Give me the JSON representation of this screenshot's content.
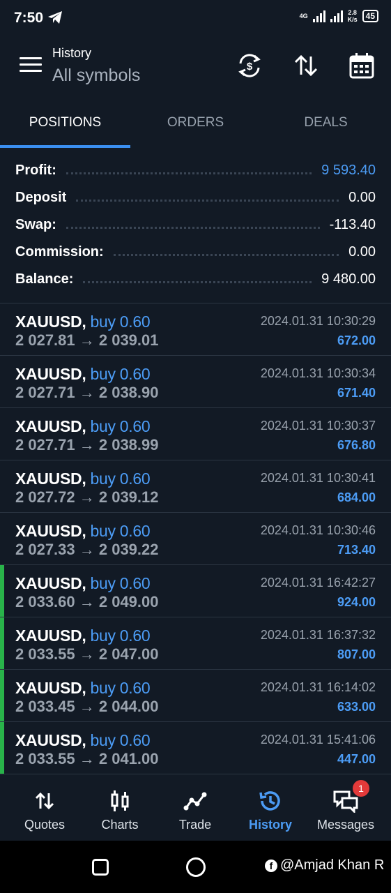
{
  "status_bar": {
    "time": "7:50",
    "network_type": "4G",
    "net_speed_value": "2.8",
    "net_speed_unit": "K/s",
    "battery": "45"
  },
  "header": {
    "title": "History",
    "subtitle": "All symbols"
  },
  "tabs": [
    {
      "label": "POSITIONS",
      "active": true
    },
    {
      "label": "ORDERS",
      "active": false
    },
    {
      "label": "DEALS",
      "active": false
    }
  ],
  "summary": [
    {
      "label": "Profit:",
      "value": "9 593.40",
      "highlight": true
    },
    {
      "label": "Deposit",
      "value": "0.00",
      "highlight": false
    },
    {
      "label": "Swap:",
      "value": "-113.40",
      "highlight": false
    },
    {
      "label": "Commission:",
      "value": "0.00",
      "highlight": false
    },
    {
      "label": "Balance:",
      "value": "9 480.00",
      "highlight": false
    }
  ],
  "positions": [
    {
      "symbol": "XAUUSD,",
      "type": "buy 0.60",
      "prices": "2 027.81 → 2 039.01",
      "datetime": "2024.01.31 10:30:29",
      "profit": "672.00",
      "marker": false
    },
    {
      "symbol": "XAUUSD,",
      "type": "buy 0.60",
      "prices": "2 027.71 → 2 038.90",
      "datetime": "2024.01.31 10:30:34",
      "profit": "671.40",
      "marker": false
    },
    {
      "symbol": "XAUUSD,",
      "type": "buy 0.60",
      "prices": "2 027.71 → 2 038.99",
      "datetime": "2024.01.31 10:30:37",
      "profit": "676.80",
      "marker": false
    },
    {
      "symbol": "XAUUSD,",
      "type": "buy 0.60",
      "prices": "2 027.72 → 2 039.12",
      "datetime": "2024.01.31 10:30:41",
      "profit": "684.00",
      "marker": false
    },
    {
      "symbol": "XAUUSD,",
      "type": "buy 0.60",
      "prices": "2 027.33 → 2 039.22",
      "datetime": "2024.01.31 10:30:46",
      "profit": "713.40",
      "marker": false
    },
    {
      "symbol": "XAUUSD,",
      "type": "buy 0.60",
      "prices": "2 033.60 → 2 049.00",
      "datetime": "2024.01.31 16:42:27",
      "profit": "924.00",
      "marker": true
    },
    {
      "symbol": "XAUUSD,",
      "type": "buy 0.60",
      "prices": "2 033.55 → 2 047.00",
      "datetime": "2024.01.31 16:37:32",
      "profit": "807.00",
      "marker": true
    },
    {
      "symbol": "XAUUSD,",
      "type": "buy 0.60",
      "prices": "2 033.45 → 2 044.00",
      "datetime": "2024.01.31 16:14:02",
      "profit": "633.00",
      "marker": true
    },
    {
      "symbol": "XAUUSD,",
      "type": "buy 0.60",
      "prices": "2 033.55 → 2 041.00",
      "datetime": "2024.01.31 15:41:06",
      "profit": "447.00",
      "marker": true
    }
  ],
  "bottom_nav": [
    {
      "label": "Quotes",
      "icon": "quotes-icon",
      "active": false
    },
    {
      "label": "Charts",
      "icon": "charts-icon",
      "active": false
    },
    {
      "label": "Trade",
      "icon": "trade-icon",
      "active": false
    },
    {
      "label": "History",
      "icon": "history-icon",
      "active": true
    },
    {
      "label": "Messages",
      "icon": "messages-icon",
      "active": false,
      "badge": "1"
    }
  ],
  "watermark": {
    "text": "@Amjad Khan R",
    "logo": "f"
  },
  "colors": {
    "background": "#121a25",
    "accent": "#4c9cf5",
    "marker": "#29b34a",
    "badge": "#e33a3a"
  }
}
